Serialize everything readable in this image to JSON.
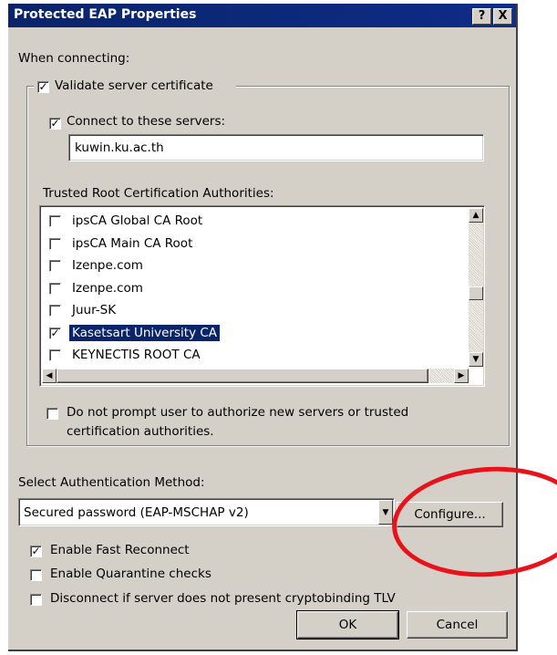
{
  "window": {
    "title": "Protected EAP Properties",
    "help_glyph": "?",
    "close_glyph": "X"
  },
  "labels": {
    "when_connecting": "When connecting:",
    "validate_cert": "Validate server certificate",
    "connect_servers": "Connect to these servers:",
    "trusted_root": "Trusted Root Certification Authorities:",
    "no_prompt_line1": "Do not prompt user to authorize new servers or trusted",
    "no_prompt_line2": "certification authorities.",
    "select_auth": "Select Authentication Method:",
    "fast_reconnect": "Enable Fast Reconnect",
    "quarantine": "Enable Quarantine checks",
    "disconnect": "Disconnect if server does not present cryptobinding TLV"
  },
  "inputs": {
    "servers_value": "kuwin.ku.ac.th"
  },
  "auth_method": {
    "selected": "Secured password (EAP-MSCHAP v2)"
  },
  "checks": {
    "validate_cert": true,
    "connect_servers": true,
    "no_prompt": false,
    "fast_reconnect": true,
    "quarantine": false,
    "disconnect": false
  },
  "ca_list": [
    {
      "label": "ipsCA Global CA Root",
      "checked": false
    },
    {
      "label": "ipsCA Main CA Root",
      "checked": false
    },
    {
      "label": "Izenpe.com",
      "checked": false
    },
    {
      "label": "Izenpe.com",
      "checked": false
    },
    {
      "label": "Juur-SK",
      "checked": false
    },
    {
      "label": "Kasetsart University CA",
      "checked": true,
      "selected": true
    },
    {
      "label": "KEYNECTIS ROOT CA",
      "checked": false
    }
  ],
  "buttons": {
    "configure": "Configure...",
    "ok": "OK",
    "cancel": "Cancel"
  },
  "colors": {
    "title_bar": "#0a246a",
    "dialog_bg": "#d4d0c8",
    "annotation": "#e8121c"
  }
}
